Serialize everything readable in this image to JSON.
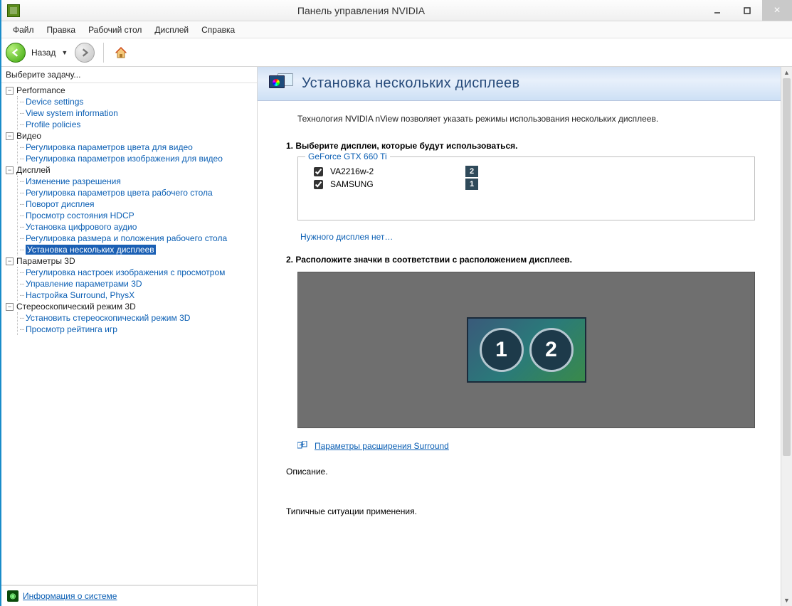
{
  "window": {
    "title": "Панель управления NVIDIA"
  },
  "menu": {
    "file": "Файл",
    "edit": "Правка",
    "desktop": "Рабочий стол",
    "display": "Дисплей",
    "help": "Справка"
  },
  "toolbar": {
    "back_label": "Назад"
  },
  "sidebar": {
    "header": "Выберите задачу...",
    "system_info": "Информация о системе",
    "cats": {
      "performance": "Performance",
      "perf_items": [
        "Device settings",
        "View system information",
        "Profile policies"
      ],
      "video": "Видео",
      "video_items": [
        "Регулировка параметров цвета для видео",
        "Регулировка параметров изображения для видео"
      ],
      "display": "Дисплей",
      "display_items": [
        "Изменение разрешения",
        "Регулировка параметров цвета рабочего стола",
        "Поворот дисплея",
        "Просмотр состояния HDCP",
        "Установка цифрового аудио",
        "Регулировка размера и положения рабочего стола",
        "Установка нескольких дисплеев"
      ],
      "params3d": "Параметры 3D",
      "params3d_items": [
        "Регулировка настроек изображения с просмотром",
        "Управление параметрами 3D",
        "Настройка Surround, PhysX"
      ],
      "stereo": "Стереоскопический режим 3D",
      "stereo_items": [
        "Установить стереоскопический режим 3D",
        "Просмотр рейтинга игр"
      ]
    }
  },
  "content": {
    "banner_title": "Установка нескольких дисплеев",
    "desc": "Технология NVIDIA nView позволяет указать режимы использования нескольких дисплеев.",
    "step1_title": "1. Выберите дисплеи, которые будут использоваться.",
    "gpu": "GeForce GTX 660 Ti",
    "displays": [
      {
        "name": "VA2216w-2",
        "badge": "2",
        "checked": true
      },
      {
        "name": "SAMSUNG",
        "badge": "1",
        "checked": true
      }
    ],
    "missing_link": "Нужного дисплея нет…",
    "step2_title": "2. Расположите значки в соответствии с расположением дисплеев.",
    "arrangement": [
      "1",
      "2"
    ],
    "surround_link": "Параметры расширения Surround",
    "description_label": "Описание.",
    "typical_label": "Типичные ситуации применения."
  }
}
